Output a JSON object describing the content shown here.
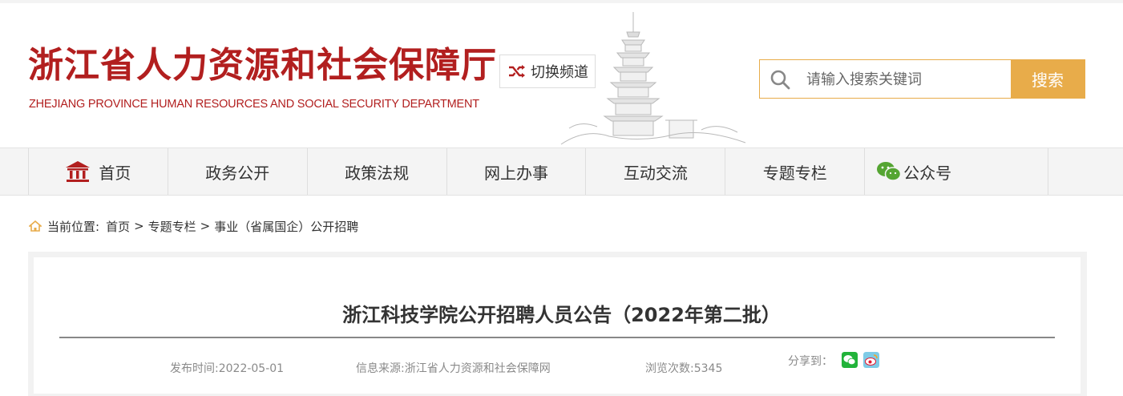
{
  "header": {
    "site_title": "浙江省人力资源和社会保障厅",
    "site_subtitle": "ZHEJIANG PROVINCE HUMAN RESOURCES AND SOCIAL SECURITY DEPARTMENT",
    "switch_label": "切换频道",
    "search_placeholder": "请输入搜索关键词",
    "search_button": "搜索"
  },
  "nav": {
    "items": [
      {
        "label": "首页",
        "icon": "home-temple-icon"
      },
      {
        "label": "政务公开"
      },
      {
        "label": "政策法规"
      },
      {
        "label": "网上办事"
      },
      {
        "label": "互动交流"
      },
      {
        "label": "专题专栏"
      },
      {
        "label": "公众号",
        "icon": "wechat-icon"
      }
    ]
  },
  "breadcrumb": {
    "prefix": "当前位置:",
    "items": [
      "首页",
      "专题专栏",
      "事业（省属国企）公开招聘"
    ],
    "separator": ">"
  },
  "article": {
    "title": "浙江科技学院公开招聘人员公告（2022年第二批）",
    "publish_time": "发布时间:2022-05-01",
    "source": "信息来源:浙江省人力资源和社会保障网",
    "views": "浏览次数:5345",
    "share_label": "分享到："
  },
  "colors": {
    "brand_red": "#b21f1f",
    "accent_orange": "#e8ac4a",
    "wechat_green": "#22b33a",
    "weibo_red": "#e6162d"
  }
}
